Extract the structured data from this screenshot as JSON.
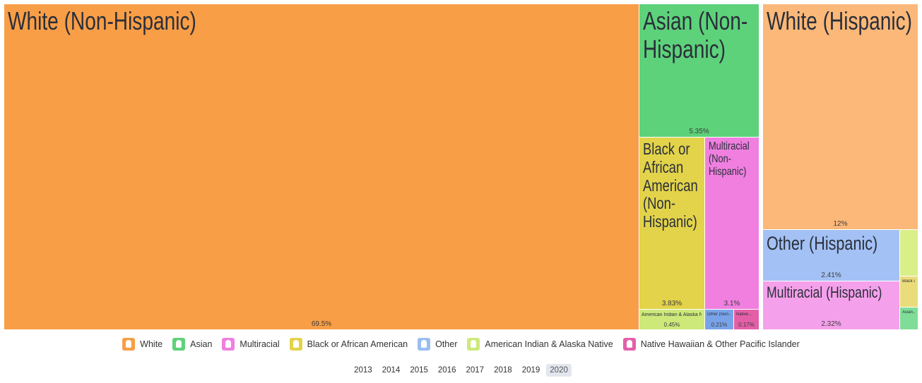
{
  "chart_data": {
    "type": "treemap",
    "title": "",
    "groups": [
      {
        "name": "White",
        "color": "#f89e47"
      },
      {
        "name": "Asian",
        "color": "#5dd27a"
      },
      {
        "name": "Multiracial",
        "color": "#f07fe0"
      },
      {
        "name": "Black or African American",
        "color": "#e2d34a"
      },
      {
        "name": "Other",
        "color": "#9cbdf2"
      },
      {
        "name": "American Indian & Alaska Native",
        "color": "#cde97a"
      },
      {
        "name": "Native Hawaiian & Other Pacific Islander",
        "color": "#e45fa8"
      }
    ],
    "items": [
      {
        "label": "White (Non-Hispanic)",
        "group": "White",
        "value": "69.5%",
        "color": "#f89e47"
      },
      {
        "label": "Asian (Non-Hispanic)",
        "group": "Asian",
        "value": "5.35%",
        "color": "#5dd27a"
      },
      {
        "label": "Black or African American (Non-Hispanic)",
        "group": "Black or African American",
        "value": "3.83%",
        "color": "#e2d34a"
      },
      {
        "label": "Multiracial (Non-Hispanic)",
        "group": "Multiracial",
        "value": "3.1%",
        "color": "#f07fe0"
      },
      {
        "label": "American Indian & Alaska Native...",
        "group": "American Indian & Alaska Native",
        "value": "0.45%",
        "color": "#cde97a"
      },
      {
        "label": "Other (Non-...",
        "group": "Other",
        "value": "0.21%",
        "color": "#79a3e8"
      },
      {
        "label": "Native...",
        "group": "Native Hawaiian & Other Pacific Islander",
        "value": "0.17%",
        "color": "#e45fa8"
      },
      {
        "label": "White (Hispanic)",
        "group": "White",
        "value": "12%",
        "color": "#fbb878"
      },
      {
        "label": "Other (Hispanic)",
        "group": "Other",
        "value": "2.41%",
        "color": "#a3c1f4"
      },
      {
        "label": "Multiracial (Hispanic)",
        "group": "Multiracial",
        "value": "2.32%",
        "color": "#f5a0eb"
      },
      {
        "label": "",
        "group": "American Indian & Alaska Native",
        "value": "",
        "color": "#d9ef8a"
      },
      {
        "label": "Black or...",
        "group": "Black or African American",
        "value": "",
        "color": "#eadc7a"
      },
      {
        "label": "Asian...",
        "group": "Asian",
        "value": "",
        "color": "#7fdd97"
      }
    ]
  },
  "legend": [
    {
      "label": "White",
      "color": "#f89e47"
    },
    {
      "label": "Asian",
      "color": "#5dd27a"
    },
    {
      "label": "Multiracial",
      "color": "#f07fe0"
    },
    {
      "label": "Black or African American",
      "color": "#e2d34a"
    },
    {
      "label": "Other",
      "color": "#9cbdf2"
    },
    {
      "label": "American Indian & Alaska Native",
      "color": "#cde97a"
    },
    {
      "label": "Native Hawaiian & Other Pacific Islander",
      "color": "#e45fa8"
    }
  ],
  "years": [
    "2013",
    "2014",
    "2015",
    "2016",
    "2017",
    "2018",
    "2019",
    "2020"
  ],
  "selected_year": "2020"
}
